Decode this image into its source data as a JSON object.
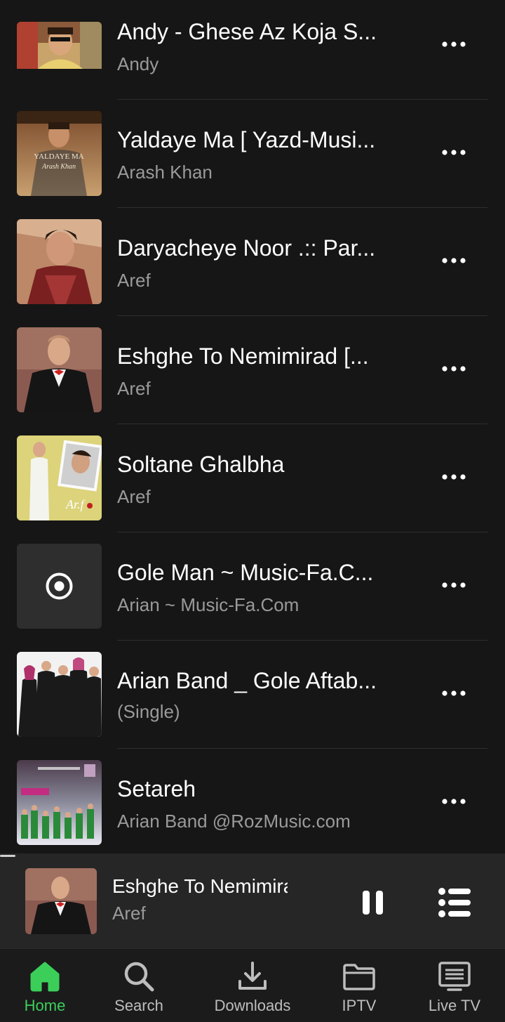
{
  "songs": [
    {
      "title": "Andy - Ghese Az Koja S...",
      "artist": "Andy",
      "art": "andy"
    },
    {
      "title": "Yaldaye Ma [ Yazd-Musi...",
      "artist": "Arash Khan",
      "art": "arash",
      "art_text": {
        "line1": "YALDAYE MA",
        "line2": "Arash Khan"
      }
    },
    {
      "title": "Daryacheye Noor .:: Par...",
      "artist": "Aref",
      "art": "aref-red"
    },
    {
      "title": "Eshghe To Nemimirad [...",
      "artist": "Aref",
      "art": "aref-tux"
    },
    {
      "title": "Soltane Ghalbha",
      "artist": "Aref",
      "art": "aref-yellow"
    },
    {
      "title": "Gole Man ~ Music-Fa.C...",
      "artist": "Arian ~ Music-Fa.Com",
      "art": "placeholder"
    },
    {
      "title": "Arian Band _ Gole Aftab...",
      "artist": "(Single)",
      "art": "arian-band"
    },
    {
      "title": "Setareh",
      "artist": "Arian Band @RozMusic.com",
      "art": "arian-green"
    }
  ],
  "now_playing": {
    "title": "Eshghe To Nemimirad",
    "artist": "Aref",
    "progress": 0.03
  },
  "nav": {
    "active": "home",
    "items": [
      {
        "id": "home",
        "label": "Home",
        "icon": "home-icon"
      },
      {
        "id": "search",
        "label": "Search",
        "icon": "search-icon"
      },
      {
        "id": "downloads",
        "label": "Downloads",
        "icon": "download-icon"
      },
      {
        "id": "iptv",
        "label": "IPTV",
        "icon": "folder-icon"
      },
      {
        "id": "livetv",
        "label": "Live TV",
        "icon": "tv-icon"
      }
    ]
  },
  "colors": {
    "background": "#161616",
    "player_background": "#262626",
    "accent": "#3bcf5a",
    "secondary_text": "#9a9a9a"
  }
}
